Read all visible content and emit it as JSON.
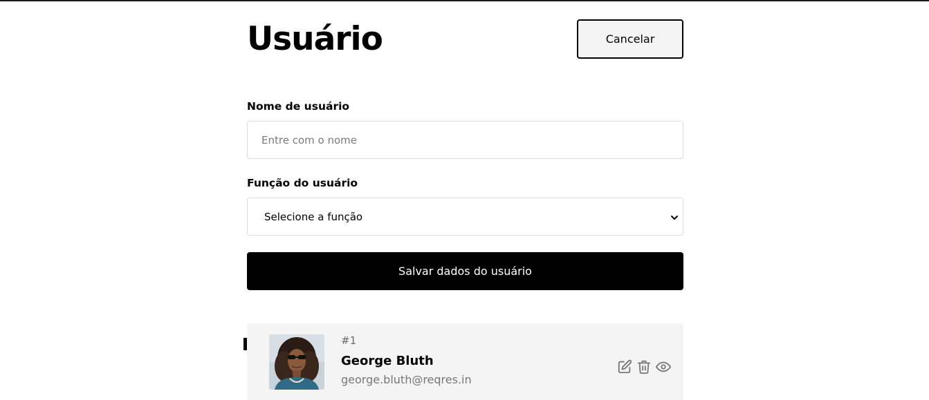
{
  "header": {
    "title": "Usuário",
    "cancel_label": "Cancelar"
  },
  "form": {
    "name_label": "Nome de usuário",
    "name_placeholder": "Entre com o nome",
    "name_value": "",
    "role_label": "Função do usuário",
    "role_selected": "Selecione a função",
    "save_label": "Salvar dados do usuário"
  },
  "users": [
    {
      "id": "#1",
      "name": "George Bluth",
      "email": "george.bluth@reqres.in",
      "actions": [
        "edit-icon",
        "trash-icon",
        "eye-icon"
      ]
    }
  ],
  "colors": {
    "primary": "#000000",
    "card_bg": "#f4f4f4",
    "border": "#dcdcdc",
    "muted_text": "#777777"
  }
}
